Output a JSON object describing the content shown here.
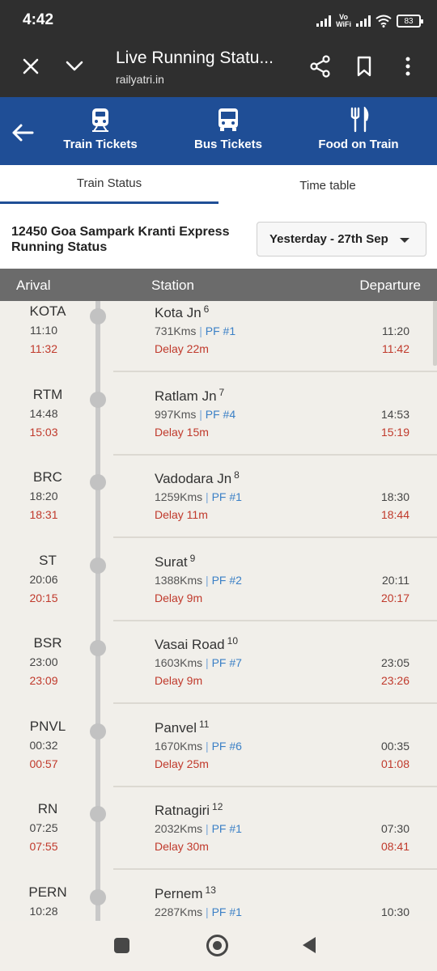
{
  "status_bar": {
    "time": "4:42",
    "vo_wifi": "Vo\nWiFi",
    "battery": "83"
  },
  "browser": {
    "title": "Live Running Statu...",
    "url": "railyatri.in"
  },
  "app_nav": {
    "items": [
      {
        "label": "Train Tickets",
        "icon": "train-icon"
      },
      {
        "label": "Bus Tickets",
        "icon": "bus-icon"
      },
      {
        "label": "Food on Train",
        "icon": "fork-knife-icon"
      }
    ]
  },
  "tabs": {
    "active": "Train Status",
    "other": "Time table"
  },
  "header": {
    "title": "12450 Goa Sampark Kranti Express Running Status",
    "date_select": "Yesterday - 27th Sep"
  },
  "table_head": {
    "arrival": "Arival",
    "station": "Station",
    "departure": "Departure"
  },
  "stations": [
    {
      "code": "KOTA",
      "name": "Kota Jn",
      "seq": "6",
      "kms": "731Kms",
      "pf": "PF #1",
      "sched_arr": "11:10",
      "act_arr": "11:32",
      "delay": "Delay 22m",
      "sched_dep": "11:20",
      "act_dep": "11:42"
    },
    {
      "code": "RTM",
      "name": "Ratlam Jn",
      "seq": "7",
      "kms": "997Kms",
      "pf": "PF #4",
      "sched_arr": "14:48",
      "act_arr": "15:03",
      "delay": "Delay 15m",
      "sched_dep": "14:53",
      "act_dep": "15:19"
    },
    {
      "code": "BRC",
      "name": "Vadodara Jn",
      "seq": "8",
      "kms": "1259Kms",
      "pf": "PF #1",
      "sched_arr": "18:20",
      "act_arr": "18:31",
      "delay": "Delay 11m",
      "sched_dep": "18:30",
      "act_dep": "18:44"
    },
    {
      "code": "ST",
      "name": "Surat",
      "seq": "9",
      "kms": "1388Kms",
      "pf": "PF #2",
      "sched_arr": "20:06",
      "act_arr": "20:15",
      "delay": "Delay 9m",
      "sched_dep": "20:11",
      "act_dep": "20:17"
    },
    {
      "code": "BSR",
      "name": "Vasai Road",
      "seq": "10",
      "kms": "1603Kms",
      "pf": "PF #7",
      "sched_arr": "23:00",
      "act_arr": "23:09",
      "delay": "Delay 9m",
      "sched_dep": "23:05",
      "act_dep": "23:26"
    },
    {
      "code": "PNVL",
      "name": "Panvel",
      "seq": "11",
      "kms": "1670Kms",
      "pf": "PF #6",
      "sched_arr": "00:32",
      "act_arr": "00:57",
      "delay": "Delay 25m",
      "sched_dep": "00:35",
      "act_dep": "01:08"
    },
    {
      "code": "RN",
      "name": "Ratnagiri",
      "seq": "12",
      "kms": "2032Kms",
      "pf": "PF #1",
      "sched_arr": "07:25",
      "act_arr": "07:55",
      "delay": "Delay 30m",
      "sched_dep": "07:30",
      "act_dep": "08:41"
    },
    {
      "code": "PERN",
      "name": "Pernem",
      "seq": "13",
      "kms": "2287Kms",
      "pf": "PF #1",
      "sched_arr": "10:28",
      "act_arr": "",
      "delay": "",
      "sched_dep": "10:30",
      "act_dep": ""
    }
  ],
  "colors": {
    "brand_blue": "#1f4e96",
    "delay_red": "#c0392b",
    "pf_blue": "#3b80c6"
  }
}
